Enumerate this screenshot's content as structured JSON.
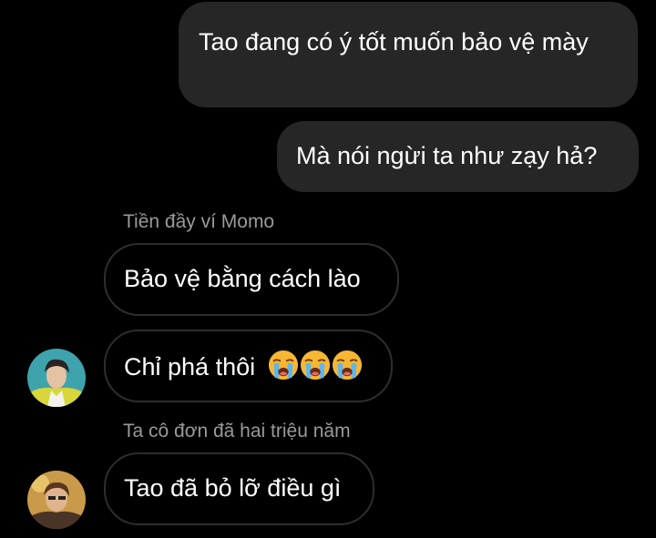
{
  "conversation": {
    "messages": [
      {
        "direction": "outgoing",
        "text": "Tao đang có ý tốt muốn bảo vệ mày"
      },
      {
        "direction": "outgoing",
        "text": "Mà nói ngừi ta như zạy hả?"
      },
      {
        "direction": "incoming",
        "sender": "Tiền đầy ví Momo",
        "text": "Bảo vệ bằng cách lào"
      },
      {
        "direction": "incoming",
        "sender": "Tiền đầy ví Momo",
        "text": "Chỉ phá thôi",
        "emoji": [
          "loudly-crying-face",
          "loudly-crying-face",
          "loudly-crying-face"
        ]
      },
      {
        "direction": "incoming",
        "sender": "Ta cô đơn đã hai triệu năm",
        "text": "Tao đã bỏ lỡ điều gì"
      }
    ]
  },
  "colors": {
    "background": "#000000",
    "outgoing_bubble": "#262626",
    "incoming_bubble_border": "#2e2e2e",
    "sender_name": "#9a9a9a",
    "text": "#ffffff"
  }
}
